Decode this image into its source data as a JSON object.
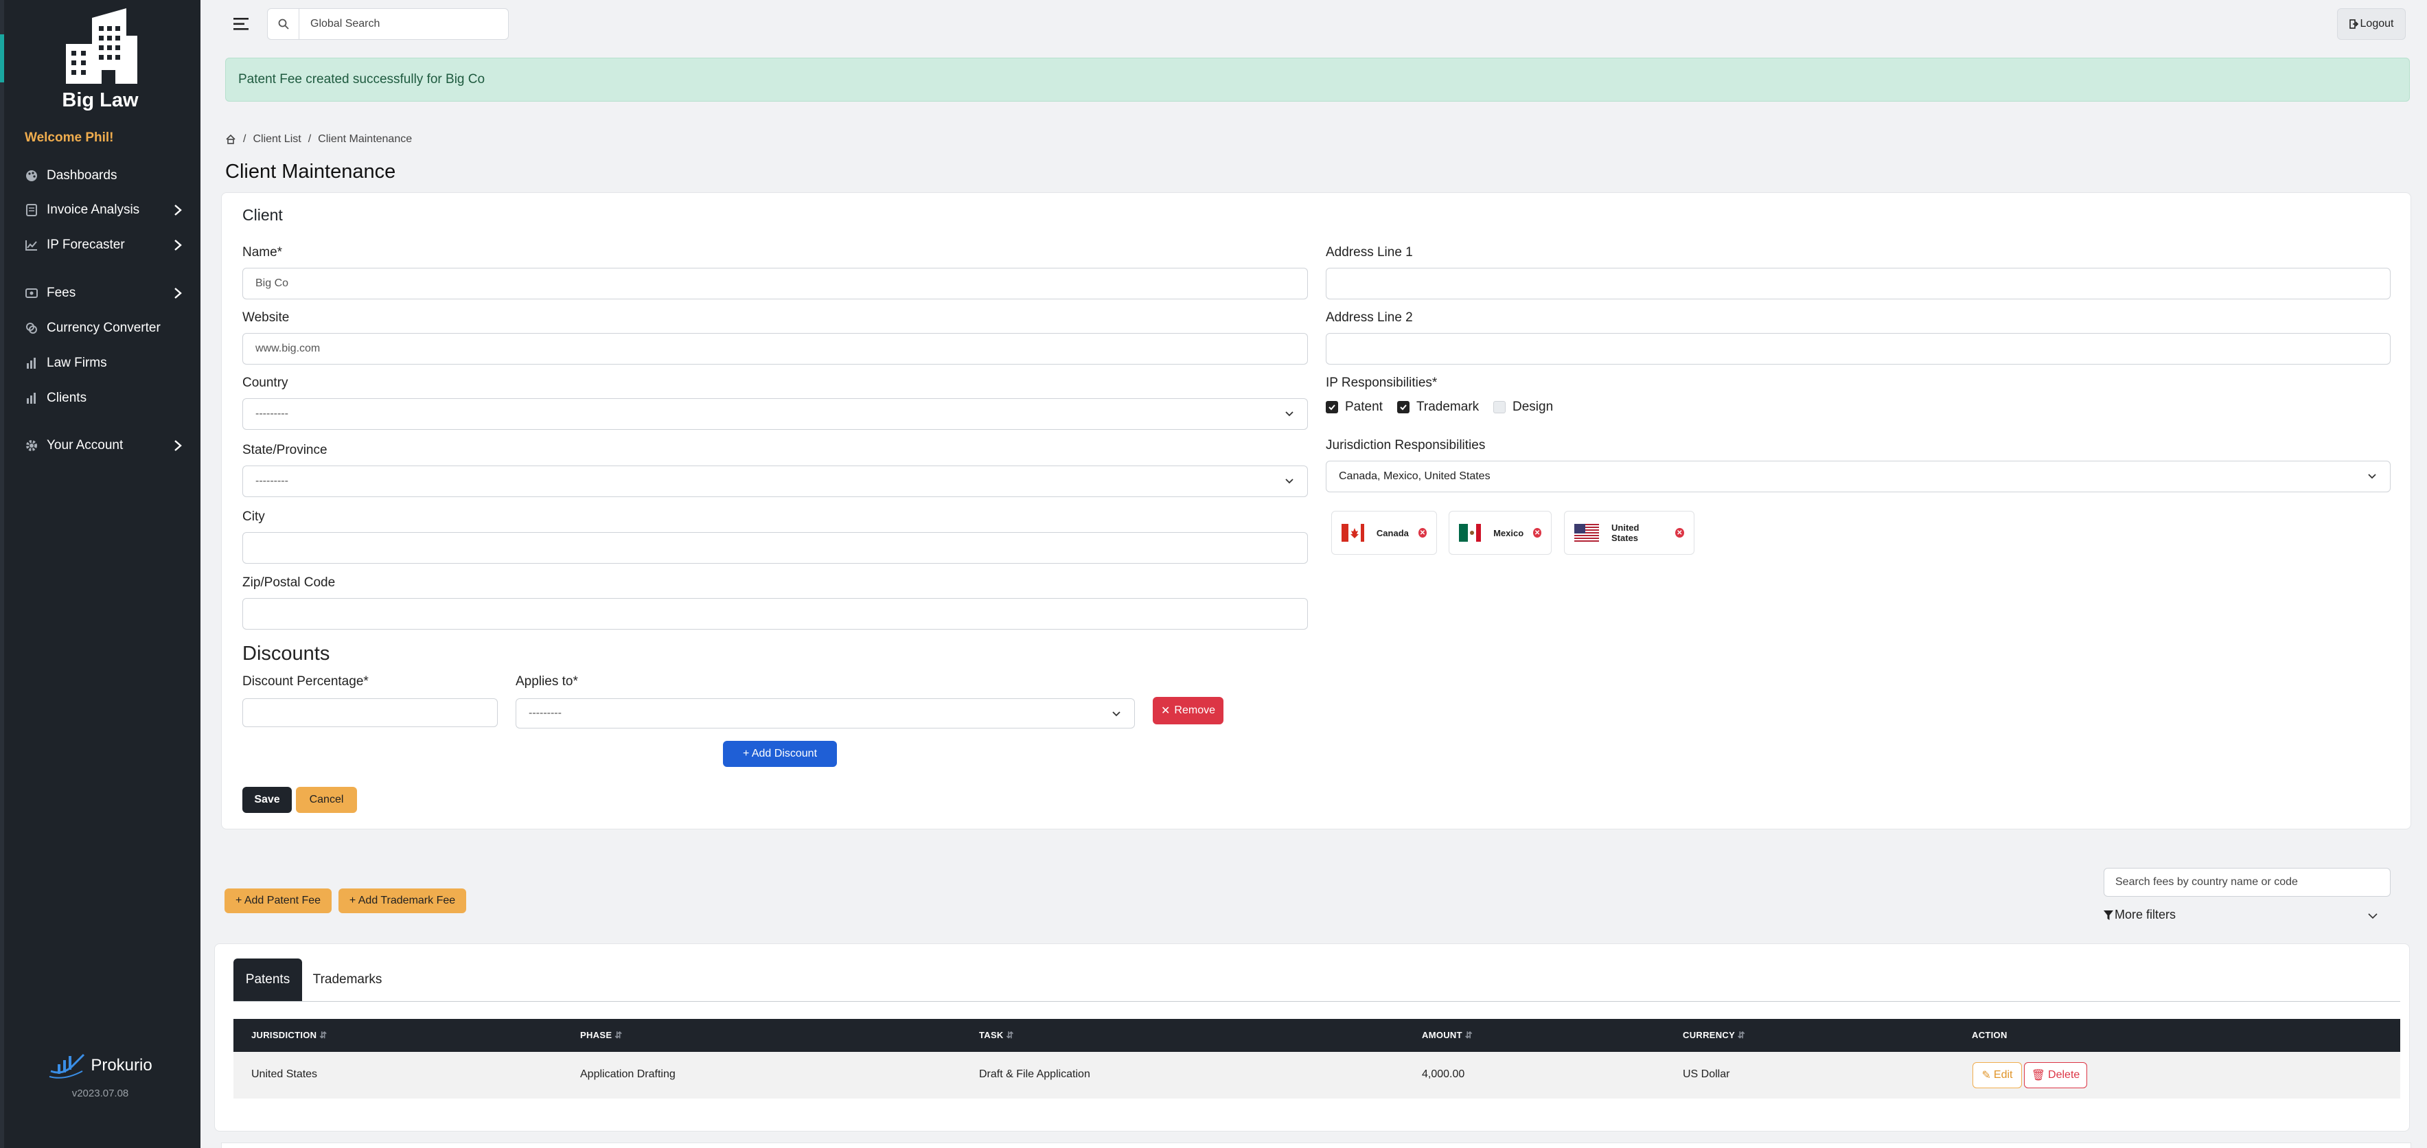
{
  "sidebar": {
    "brand": "Big Law",
    "welcome": "Welcome Phil!",
    "items": [
      {
        "label": "Dashboards",
        "icon": "palette-icon"
      },
      {
        "label": "Invoice Analysis",
        "icon": "invoice-icon"
      },
      {
        "label": "IP Forecaster",
        "icon": "chart-line-icon"
      },
      {
        "label": "Fees",
        "icon": "money-icon"
      },
      {
        "label": "Currency Converter",
        "icon": "coins-icon"
      },
      {
        "label": "Law Firms",
        "icon": "bar-chart-icon"
      },
      {
        "label": "Clients",
        "icon": "bar-chart-icon"
      },
      {
        "label": "Your Account",
        "icon": "gear-icon"
      }
    ],
    "footer_brand": "Prokurio",
    "version": "v2023.07.08"
  },
  "topbar": {
    "search_placeholder": "Global Search",
    "logout": "Logout"
  },
  "alert": "Patent Fee created successfully for Big Co",
  "breadcrumb": [
    "Client List",
    "Client Maintenance"
  ],
  "page_title": "Client Maintenance",
  "form": {
    "card_title": "Client",
    "name_label": "Name*",
    "name_value": "Big Co",
    "website_label": "Website",
    "website_value": "www.big.com",
    "country_label": "Country",
    "country_value": "---------",
    "state_label": "State/Province",
    "state_value": "---------",
    "city_label": "City",
    "zip_label": "Zip/Postal Code",
    "addr1_label": "Address Line 1",
    "addr2_label": "Address Line 2",
    "ip_label": "IP Responsibilities*",
    "ip_options": [
      {
        "label": "Patent",
        "checked": true
      },
      {
        "label": "Trademark",
        "checked": true
      },
      {
        "label": "Design",
        "checked": false
      }
    ],
    "jur_label": "Jurisdiction Responsibilities",
    "jur_value": "Canada, Mexico, United States",
    "jur_chips": [
      "Canada",
      "Mexico",
      "United States"
    ],
    "discounts_title": "Discounts",
    "discount_pct_label": "Discount Percentage*",
    "applies_label": "Applies to*",
    "applies_value": "---------",
    "remove": "Remove",
    "add_discount": "+ Add Discount",
    "save": "Save",
    "cancel": "Cancel"
  },
  "fees": {
    "add_patent": "+ Add Patent Fee",
    "add_trademark": "+ Add Trademark Fee",
    "search_placeholder": "Search fees by country name or code",
    "more_filters": "More filters",
    "tabs": [
      "Patents",
      "Trademarks"
    ],
    "columns": [
      "JURISDICTION",
      "PHASE",
      "TASK",
      "AMOUNT",
      "CURRENCY",
      "ACTION"
    ],
    "rows": [
      {
        "jurisdiction": "United States",
        "phase": "Application Drafting",
        "task": "Draft & File Application",
        "amount": "4,000.00",
        "currency": "US Dollar"
      }
    ],
    "edit": "Edit",
    "delete": "Delete"
  },
  "colors": {
    "sidebar": "#1e2329",
    "accent": "#f0ad4e",
    "primary": "#1f5fd6",
    "danger": "#dc3545",
    "success_bg": "#cfece0"
  }
}
